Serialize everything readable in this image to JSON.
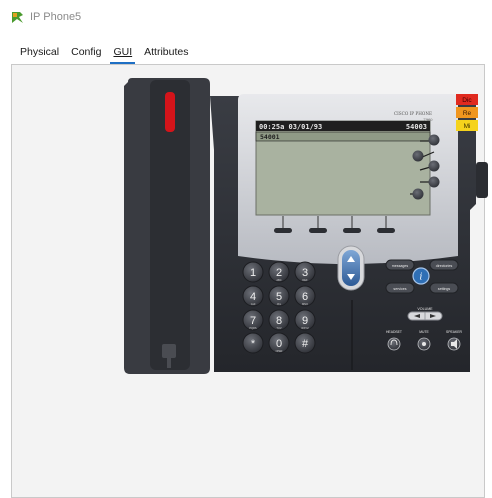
{
  "window": {
    "title": "IP Phone5"
  },
  "tabs": [
    {
      "label": "Physical",
      "active": false
    },
    {
      "label": "Config",
      "active": false
    },
    {
      "label": "GUI",
      "active": true
    },
    {
      "label": "Attributes",
      "active": false
    }
  ],
  "phone": {
    "brand": "CISCO IP PHONE",
    "model": "7960",
    "lcd": {
      "datetime": "00:25a 03/01/93",
      "extension": "54003",
      "line1": "54001"
    },
    "side_labels": [
      {
        "text": "Dic",
        "color": "#e02a1f"
      },
      {
        "text": "Re",
        "color": "#f0961e"
      },
      {
        "text": "Mi",
        "color": "#f5d31c"
      }
    ],
    "keypad": [
      {
        "digit": "1",
        "letters": ""
      },
      {
        "digit": "2",
        "letters": "ABC"
      },
      {
        "digit": "3",
        "letters": "DEF"
      },
      {
        "digit": "4",
        "letters": "GHI"
      },
      {
        "digit": "5",
        "letters": "JKL"
      },
      {
        "digit": "6",
        "letters": "MNO"
      },
      {
        "digit": "7",
        "letters": "PQRS"
      },
      {
        "digit": "8",
        "letters": "TUV"
      },
      {
        "digit": "9",
        "letters": "WXYZ"
      },
      {
        "digit": "*",
        "letters": ""
      },
      {
        "digit": "0",
        "letters": "OPER"
      },
      {
        "digit": "#",
        "letters": ""
      }
    ],
    "function_keys": {
      "messages": "messages",
      "directories": "directories",
      "services": "services",
      "settings": "settings"
    },
    "volume_label": "VOLUME",
    "bottom_labels": {
      "headset": "HEADSET",
      "mute": "MUTE",
      "speaker": "SPEAKER"
    }
  },
  "colors": {
    "tab_underline": "#1e6fc4",
    "handset_led": "#d4141a",
    "lcd_bg": "#a9b2a0",
    "lcd_highlight": "#1f1f1f"
  }
}
